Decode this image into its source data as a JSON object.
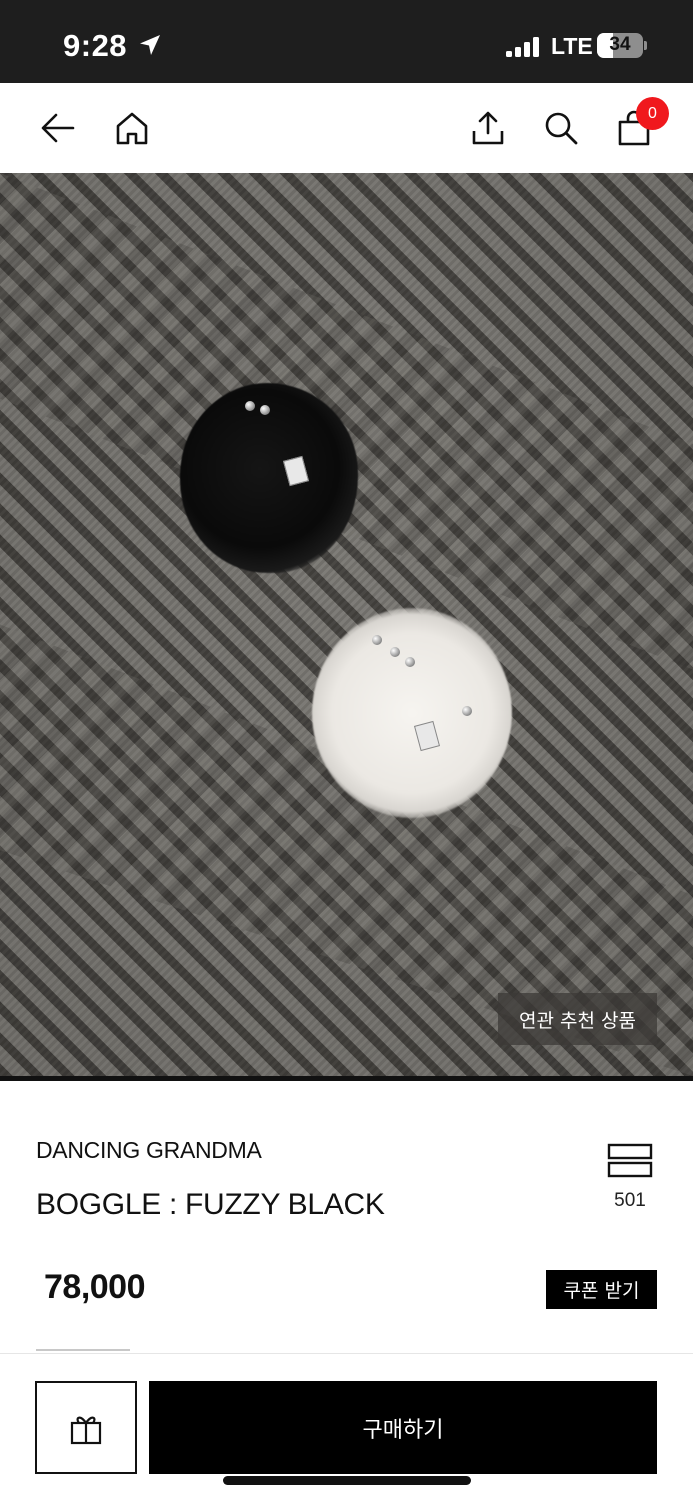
{
  "status_bar": {
    "time": "9:28",
    "network": "LTE",
    "battery_level": "34",
    "battery_fraction": 0.34,
    "icons": [
      "location-arrow-icon",
      "signal-bars-icon",
      "battery-icon"
    ]
  },
  "nav": {
    "icons": [
      "back-arrow-icon",
      "home-icon",
      "share-icon",
      "search-icon",
      "shopping-bag-icon"
    ],
    "cart_count": "0",
    "badge_color": "#f0181d"
  },
  "photo": {
    "related_label": "연관 추천 상품"
  },
  "product": {
    "brand": "DANCING GRANDMA",
    "name": "BOGGLE : FUZZY BLACK",
    "price": "78,000",
    "wish_count": "501",
    "coupon_label": "쿠폰 받기"
  },
  "bottom_bar": {
    "gift_icon": "gift-icon",
    "buy_label": "구매하기"
  },
  "colors": {
    "status_bg": "#1e1e1e",
    "primary": "#000000",
    "badge": "#f0181d"
  }
}
